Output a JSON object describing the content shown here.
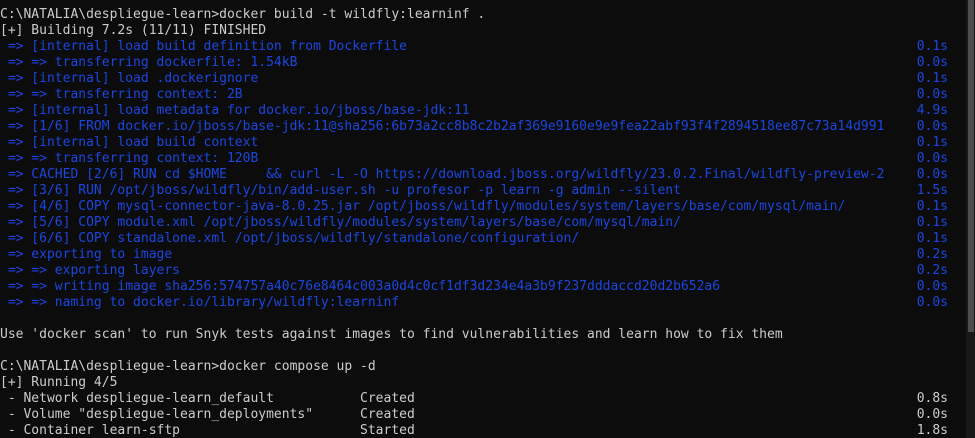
{
  "terminal": {
    "lines": [
      {
        "text": "C:\\NATALIA\\despliegue-learn>docker build -t wildfly:learninf .",
        "time": ""
      },
      {
        "text": "[+] Building 7.2s (11/11) FINISHED",
        "time": ""
      },
      {
        "text": " => [internal] load build definition from Dockerfile",
        "time": "0.1s"
      },
      {
        "text": " => => transferring dockerfile: 1.54kB",
        "time": "0.0s"
      },
      {
        "text": " => [internal] load .dockerignore",
        "time": "0.1s"
      },
      {
        "text": " => => transferring context: 2B",
        "time": "0.0s"
      },
      {
        "text": " => [internal] load metadata for docker.io/jboss/base-jdk:11",
        "time": "4.9s"
      },
      {
        "text": " => [1/6] FROM docker.io/jboss/base-jdk:11@sha256:6b73a2cc8b8c2b2af369e9160e9e9fea22abf93f4f2894518ee87c73a14d991",
        "time": "0.0s"
      },
      {
        "text": " => [internal] load build context",
        "time": "0.1s"
      },
      {
        "text": " => => transferring context: 120B",
        "time": "0.0s"
      },
      {
        "text": " => CACHED [2/6] RUN cd $HOME     && curl -L -O https://download.jboss.org/wildfly/23.0.2.Final/wildfly-preview-2",
        "time": "0.0s"
      },
      {
        "text": " => [3/6] RUN /opt/jboss/wildfly/bin/add-user.sh -u profesor -p learn -g admin --silent",
        "time": "1.5s"
      },
      {
        "text": " => [4/6] COPY mysql-connector-java-8.0.25.jar /opt/jboss/wildfly/modules/system/layers/base/com/mysql/main/",
        "time": "0.1s"
      },
      {
        "text": " => [5/6] COPY module.xml /opt/jboss/wildfly/modules/system/layers/base/com/mysql/main/",
        "time": "0.1s"
      },
      {
        "text": " => [6/6] COPY standalone.xml /opt/jboss/wildfly/standalone/configuration/",
        "time": "0.1s"
      },
      {
        "text": " => exporting to image",
        "time": "0.2s"
      },
      {
        "text": " => => exporting layers",
        "time": "0.2s"
      },
      {
        "text": " => => writing image sha256:574757a40c76e8464c003a0d4c0cf1df3d234e4a3b9f237dddaccd20d2b652a6",
        "time": "0.0s"
      },
      {
        "text": " => => naming to docker.io/library/wildfly:learninf",
        "time": "0.0s"
      },
      {
        "text": "",
        "time": ""
      },
      {
        "text": "Use 'docker scan' to run Snyk tests against images to find vulnerabilities and learn how to fix them",
        "time": ""
      },
      {
        "text": "",
        "time": ""
      },
      {
        "text": "C:\\NATALIA\\despliegue-learn>docker compose up -d",
        "time": ""
      },
      {
        "text": "[+] Running 4/5",
        "time": ""
      },
      {
        "text": " - Network despliegue-learn_default",
        "status": "Created",
        "time": "0.8s"
      },
      {
        "text": " - Volume \"despliegue-learn_deployments\"",
        "status": "Created",
        "time": "0.0s"
      },
      {
        "text": " - Container learn-sftp",
        "status": "Started",
        "time": "1.8s"
      }
    ]
  },
  "colors": {
    "background": "#0c0c0c",
    "default_text": "#cccccc",
    "build_step_text": "#1c46e0"
  }
}
